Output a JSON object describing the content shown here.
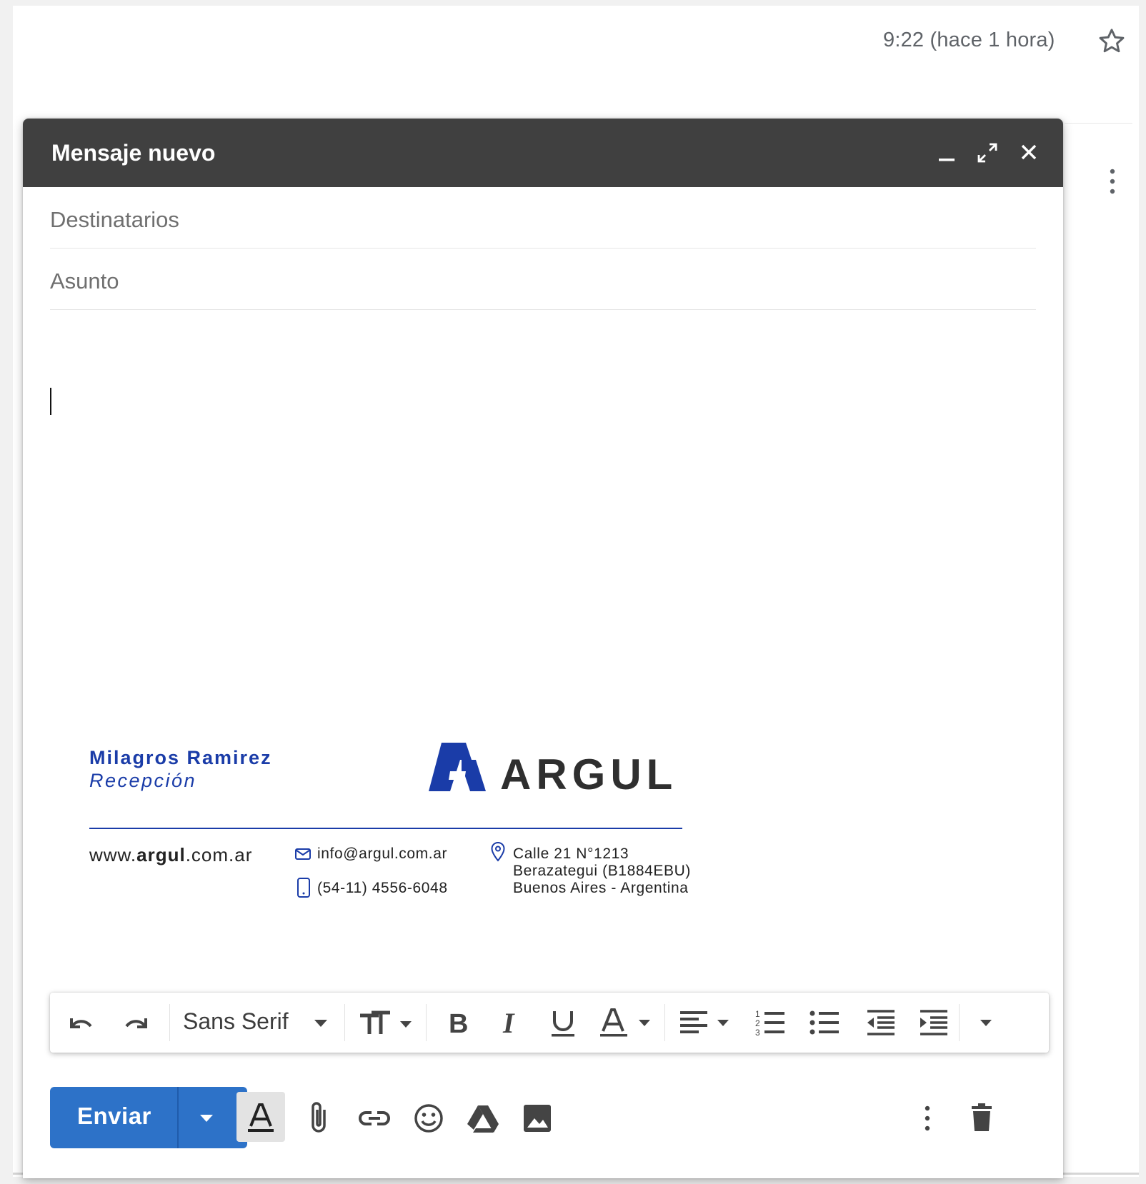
{
  "header": {
    "time": "9:22 (hace 1 hora)"
  },
  "compose": {
    "title": "Mensaje nuevo",
    "recipients_placeholder": "Destinatarios",
    "subject_placeholder": "Asunto",
    "body": ""
  },
  "signature": {
    "name": "Milagros Ramirez",
    "role": "Recepción",
    "logo_text": "ARGUL",
    "website_prefix": "www.",
    "website_bold": "argul",
    "website_suffix": ".com.ar",
    "email": "info@argul.com.ar",
    "phone": "(54-11) 4556-6048",
    "address_line1": "Calle 21 N°1213",
    "address_line2": "Berazategui (B1884EBU)",
    "address_line3": "Buenos Aires - Argentina",
    "brand_color": "#1a3ca8"
  },
  "toolbar": {
    "font": "Sans Serif",
    "icons": [
      "undo-icon",
      "redo-icon",
      "font-dropdown",
      "text-size-icon",
      "bold-icon",
      "italic-icon",
      "underline-icon",
      "text-color-icon",
      "align-icon",
      "numbered-list-icon",
      "bulleted-list-icon",
      "indent-less-icon",
      "indent-more-icon",
      "more-formatting-icon"
    ]
  },
  "actions": {
    "send_label": "Enviar",
    "send_color": "#2d72c8",
    "icons": [
      "formatting-toggle-icon",
      "attach-icon",
      "link-icon",
      "emoji-icon",
      "drive-icon",
      "photo-icon",
      "more-options-icon",
      "trash-icon"
    ]
  }
}
